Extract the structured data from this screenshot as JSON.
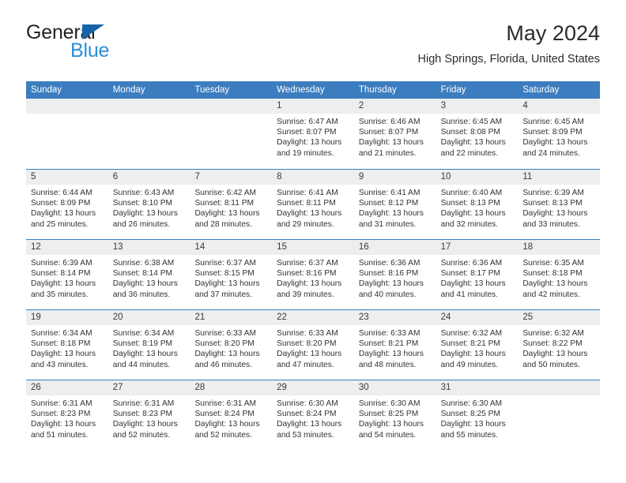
{
  "brand": {
    "name_part1": "General",
    "name_part2": "Blue",
    "triangle_color": "#1565a8",
    "blue_color": "#2b8fd6"
  },
  "header": {
    "title": "May 2024",
    "subtitle": "High Springs, Florida, United States"
  },
  "theme": {
    "header_blue": "#3b7dbf",
    "day_strip_gray": "#eeeeee",
    "text_color": "#333333"
  },
  "weekdays": [
    "Sunday",
    "Monday",
    "Tuesday",
    "Wednesday",
    "Thursday",
    "Friday",
    "Saturday"
  ],
  "weeks": [
    [
      {
        "day": "",
        "sunrise": "",
        "sunset": "",
        "daylight_line1": "",
        "daylight_line2": ""
      },
      {
        "day": "",
        "sunrise": "",
        "sunset": "",
        "daylight_line1": "",
        "daylight_line2": ""
      },
      {
        "day": "",
        "sunrise": "",
        "sunset": "",
        "daylight_line1": "",
        "daylight_line2": ""
      },
      {
        "day": "1",
        "sunrise": "Sunrise: 6:47 AM",
        "sunset": "Sunset: 8:07 PM",
        "daylight_line1": "Daylight: 13 hours",
        "daylight_line2": "and 19 minutes."
      },
      {
        "day": "2",
        "sunrise": "Sunrise: 6:46 AM",
        "sunset": "Sunset: 8:07 PM",
        "daylight_line1": "Daylight: 13 hours",
        "daylight_line2": "and 21 minutes."
      },
      {
        "day": "3",
        "sunrise": "Sunrise: 6:45 AM",
        "sunset": "Sunset: 8:08 PM",
        "daylight_line1": "Daylight: 13 hours",
        "daylight_line2": "and 22 minutes."
      },
      {
        "day": "4",
        "sunrise": "Sunrise: 6:45 AM",
        "sunset": "Sunset: 8:09 PM",
        "daylight_line1": "Daylight: 13 hours",
        "daylight_line2": "and 24 minutes."
      }
    ],
    [
      {
        "day": "5",
        "sunrise": "Sunrise: 6:44 AM",
        "sunset": "Sunset: 8:09 PM",
        "daylight_line1": "Daylight: 13 hours",
        "daylight_line2": "and 25 minutes."
      },
      {
        "day": "6",
        "sunrise": "Sunrise: 6:43 AM",
        "sunset": "Sunset: 8:10 PM",
        "daylight_line1": "Daylight: 13 hours",
        "daylight_line2": "and 26 minutes."
      },
      {
        "day": "7",
        "sunrise": "Sunrise: 6:42 AM",
        "sunset": "Sunset: 8:11 PM",
        "daylight_line1": "Daylight: 13 hours",
        "daylight_line2": "and 28 minutes."
      },
      {
        "day": "8",
        "sunrise": "Sunrise: 6:41 AM",
        "sunset": "Sunset: 8:11 PM",
        "daylight_line1": "Daylight: 13 hours",
        "daylight_line2": "and 29 minutes."
      },
      {
        "day": "9",
        "sunrise": "Sunrise: 6:41 AM",
        "sunset": "Sunset: 8:12 PM",
        "daylight_line1": "Daylight: 13 hours",
        "daylight_line2": "and 31 minutes."
      },
      {
        "day": "10",
        "sunrise": "Sunrise: 6:40 AM",
        "sunset": "Sunset: 8:13 PM",
        "daylight_line1": "Daylight: 13 hours",
        "daylight_line2": "and 32 minutes."
      },
      {
        "day": "11",
        "sunrise": "Sunrise: 6:39 AM",
        "sunset": "Sunset: 8:13 PM",
        "daylight_line1": "Daylight: 13 hours",
        "daylight_line2": "and 33 minutes."
      }
    ],
    [
      {
        "day": "12",
        "sunrise": "Sunrise: 6:39 AM",
        "sunset": "Sunset: 8:14 PM",
        "daylight_line1": "Daylight: 13 hours",
        "daylight_line2": "and 35 minutes."
      },
      {
        "day": "13",
        "sunrise": "Sunrise: 6:38 AM",
        "sunset": "Sunset: 8:14 PM",
        "daylight_line1": "Daylight: 13 hours",
        "daylight_line2": "and 36 minutes."
      },
      {
        "day": "14",
        "sunrise": "Sunrise: 6:37 AM",
        "sunset": "Sunset: 8:15 PM",
        "daylight_line1": "Daylight: 13 hours",
        "daylight_line2": "and 37 minutes."
      },
      {
        "day": "15",
        "sunrise": "Sunrise: 6:37 AM",
        "sunset": "Sunset: 8:16 PM",
        "daylight_line1": "Daylight: 13 hours",
        "daylight_line2": "and 39 minutes."
      },
      {
        "day": "16",
        "sunrise": "Sunrise: 6:36 AM",
        "sunset": "Sunset: 8:16 PM",
        "daylight_line1": "Daylight: 13 hours",
        "daylight_line2": "and 40 minutes."
      },
      {
        "day": "17",
        "sunrise": "Sunrise: 6:36 AM",
        "sunset": "Sunset: 8:17 PM",
        "daylight_line1": "Daylight: 13 hours",
        "daylight_line2": "and 41 minutes."
      },
      {
        "day": "18",
        "sunrise": "Sunrise: 6:35 AM",
        "sunset": "Sunset: 8:18 PM",
        "daylight_line1": "Daylight: 13 hours",
        "daylight_line2": "and 42 minutes."
      }
    ],
    [
      {
        "day": "19",
        "sunrise": "Sunrise: 6:34 AM",
        "sunset": "Sunset: 8:18 PM",
        "daylight_line1": "Daylight: 13 hours",
        "daylight_line2": "and 43 minutes."
      },
      {
        "day": "20",
        "sunrise": "Sunrise: 6:34 AM",
        "sunset": "Sunset: 8:19 PM",
        "daylight_line1": "Daylight: 13 hours",
        "daylight_line2": "and 44 minutes."
      },
      {
        "day": "21",
        "sunrise": "Sunrise: 6:33 AM",
        "sunset": "Sunset: 8:20 PM",
        "daylight_line1": "Daylight: 13 hours",
        "daylight_line2": "and 46 minutes."
      },
      {
        "day": "22",
        "sunrise": "Sunrise: 6:33 AM",
        "sunset": "Sunset: 8:20 PM",
        "daylight_line1": "Daylight: 13 hours",
        "daylight_line2": "and 47 minutes."
      },
      {
        "day": "23",
        "sunrise": "Sunrise: 6:33 AM",
        "sunset": "Sunset: 8:21 PM",
        "daylight_line1": "Daylight: 13 hours",
        "daylight_line2": "and 48 minutes."
      },
      {
        "day": "24",
        "sunrise": "Sunrise: 6:32 AM",
        "sunset": "Sunset: 8:21 PM",
        "daylight_line1": "Daylight: 13 hours",
        "daylight_line2": "and 49 minutes."
      },
      {
        "day": "25",
        "sunrise": "Sunrise: 6:32 AM",
        "sunset": "Sunset: 8:22 PM",
        "daylight_line1": "Daylight: 13 hours",
        "daylight_line2": "and 50 minutes."
      }
    ],
    [
      {
        "day": "26",
        "sunrise": "Sunrise: 6:31 AM",
        "sunset": "Sunset: 8:23 PM",
        "daylight_line1": "Daylight: 13 hours",
        "daylight_line2": "and 51 minutes."
      },
      {
        "day": "27",
        "sunrise": "Sunrise: 6:31 AM",
        "sunset": "Sunset: 8:23 PM",
        "daylight_line1": "Daylight: 13 hours",
        "daylight_line2": "and 52 minutes."
      },
      {
        "day": "28",
        "sunrise": "Sunrise: 6:31 AM",
        "sunset": "Sunset: 8:24 PM",
        "daylight_line1": "Daylight: 13 hours",
        "daylight_line2": "and 52 minutes."
      },
      {
        "day": "29",
        "sunrise": "Sunrise: 6:30 AM",
        "sunset": "Sunset: 8:24 PM",
        "daylight_line1": "Daylight: 13 hours",
        "daylight_line2": "and 53 minutes."
      },
      {
        "day": "30",
        "sunrise": "Sunrise: 6:30 AM",
        "sunset": "Sunset: 8:25 PM",
        "daylight_line1": "Daylight: 13 hours",
        "daylight_line2": "and 54 minutes."
      },
      {
        "day": "31",
        "sunrise": "Sunrise: 6:30 AM",
        "sunset": "Sunset: 8:25 PM",
        "daylight_line1": "Daylight: 13 hours",
        "daylight_line2": "and 55 minutes."
      },
      {
        "day": "",
        "sunrise": "",
        "sunset": "",
        "daylight_line1": "",
        "daylight_line2": ""
      }
    ]
  ]
}
